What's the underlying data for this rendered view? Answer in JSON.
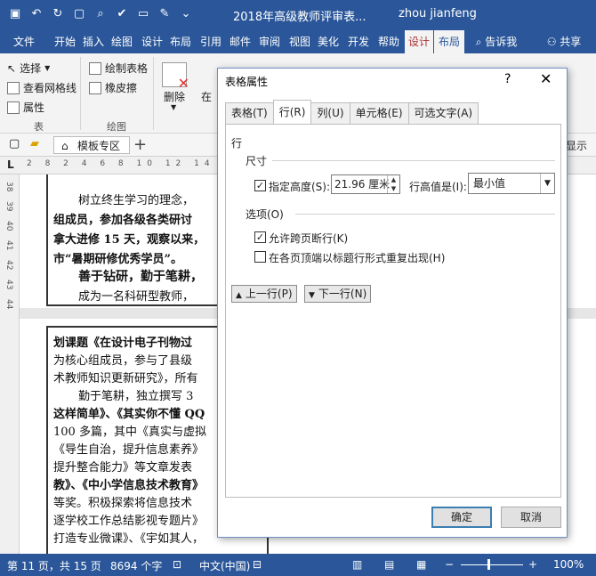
{
  "window": {
    "title": "2018年高级教师评审表...",
    "user": "zhou jianfeng"
  },
  "ribbon_tabs": [
    {
      "label": "文件"
    },
    {
      "label": "开始"
    },
    {
      "label": "插入"
    },
    {
      "label": "绘图"
    },
    {
      "label": "设计"
    },
    {
      "label": "布局"
    },
    {
      "label": "引用"
    },
    {
      "label": "邮件"
    },
    {
      "label": "审阅"
    },
    {
      "label": "视图"
    },
    {
      "label": "美化"
    },
    {
      "label": "开发"
    },
    {
      "label": "帮助"
    },
    {
      "label": "设计"
    },
    {
      "label": "布局"
    }
  ],
  "tell_me": "告诉我",
  "share": "共享",
  "ribbon": {
    "select": "选择",
    "view_gridlines": "查看网格线",
    "properties": "属性",
    "group_table": "表",
    "draw_table": "绘制表格",
    "eraser": "橡皮擦",
    "group_draw": "绘图",
    "delete": "删除",
    "insert_partial": "在"
  },
  "doc_tab": "模板专区",
  "doc_right_label": "显示",
  "ruler_top": "2 8 2 4 6 8 10 12 14 16 18 20 22 24 26 28 30 32",
  "ruler_left": [
    "38",
    "39",
    "40",
    "41",
    "42",
    "43",
    "44"
  ],
  "document": {
    "lines_top": [
      "树立终生学习的理念，",
      "组成员，参加各级各类研讨",
      "拿大进修 15 天，观察以来，",
      "市“暑期研修优秀学员”。",
      "善于钻研，勤于笔耕，",
      "成为一名科研型教师，"
    ],
    "lines_bottom": [
      "划课题《在设计电子刊物过",
      "为核心组成员，参与了县级",
      "术教师知识更新研究》，所有",
      "勤于笔耕，独立撰写 3",
      "这样简单》、《其实你不懂 QQ",
      "100 多篇，其中《真实与虚拟",
      "《导生自治，提升信息素养》",
      "提升整合能力》等文章发表",
      "教》、《中小学信息技术教育》",
      "等奖。积极探索将信息技术",
      "逐学校工作总结影视专题片》",
      "打造专业微课》、《宇如其人，"
    ]
  },
  "status": {
    "page": "第 11 页，共 15 页",
    "words": "8694 个字",
    "language": "中文(中国)",
    "zoom": "100%",
    "zoom_percent": 100
  },
  "dialog": {
    "title": "表格属性",
    "help": "?",
    "tabs": [
      {
        "label": "表格(T)",
        "active": false
      },
      {
        "label": "行(R)",
        "active": true
      },
      {
        "label": "列(U)",
        "active": false
      },
      {
        "label": "单元格(E)",
        "active": false
      },
      {
        "label": "可选文字(A)",
        "active": false
      }
    ],
    "row_heading": "行",
    "size_heading": "尺寸",
    "specify_height": {
      "label": "指定高度(S):",
      "checked": true
    },
    "height_value": "21.96 厘米",
    "height_is_label": "行高值是(I):",
    "height_mode": "最小值",
    "options_heading": "选项(O)",
    "allow_break": {
      "label": "允许跨页断行(K)",
      "checked": true
    },
    "repeat_header": {
      "label": "在各页顶端以标题行形式重复出现(H)",
      "checked": false
    },
    "prev_row": "上一行(P)",
    "next_row": "下一行(N)",
    "ok": "确定",
    "cancel": "取消"
  }
}
